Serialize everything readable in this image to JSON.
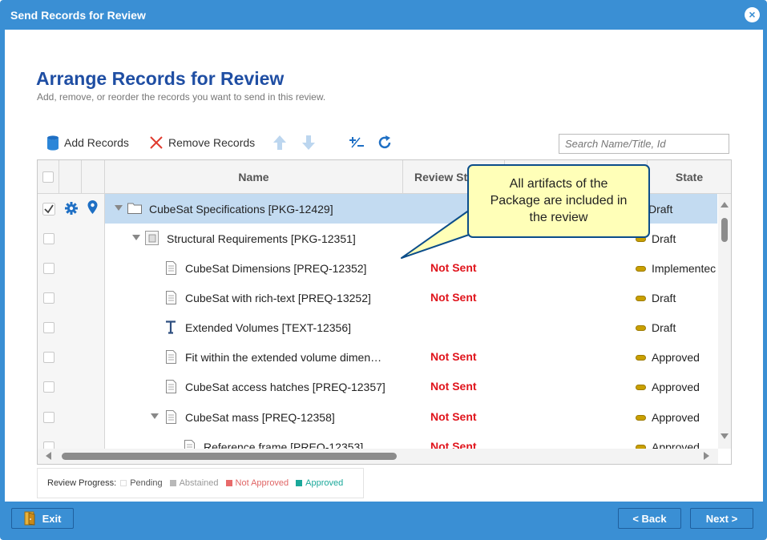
{
  "window": {
    "title": "Send Records for Review",
    "close_glyph": "×"
  },
  "header": {
    "title": "Arrange Records for Review",
    "subtitle": "Add, remove, or reorder the records you want to send in this review."
  },
  "toolbar": {
    "add_label": "Add Records",
    "remove_label": "Remove Records",
    "search_placeholder": "Search Name/Title, Id"
  },
  "grid": {
    "columns": {
      "name": "Name",
      "review_status": "Review St",
      "state": "State"
    },
    "rows": [
      {
        "name": "CubeSat Specifications [PKG-12429]",
        "status": "",
        "state": "Draft",
        "icon": "folder-icon",
        "depth": 0,
        "selected": true
      },
      {
        "name": "Structural Requirements [PKG-12351]",
        "status": "",
        "state": "Draft",
        "icon": "package-icon",
        "depth": 1,
        "selected": false
      },
      {
        "name": "CubeSat Dimensions [PREQ-12352]",
        "status": "Not Sent",
        "state": "Implementec",
        "icon": "document-icon",
        "depth": 2,
        "selected": false
      },
      {
        "name": "CubeSat with rich-text [PREQ-13252]",
        "status": "Not Sent",
        "state": "Draft",
        "icon": "document-icon",
        "depth": 2,
        "selected": false
      },
      {
        "name": "Extended Volumes [TEXT-12356]",
        "status": "",
        "state": "Draft",
        "icon": "text-icon",
        "depth": 2,
        "selected": false
      },
      {
        "name": "Fit within the extended volume dimen…",
        "status": "Not Sent",
        "state": "Approved",
        "icon": "document-icon",
        "depth": 2,
        "selected": false
      },
      {
        "name": "CubeSat access hatches [PREQ-12357]",
        "status": "Not Sent",
        "state": "Approved",
        "icon": "document-icon",
        "depth": 2,
        "selected": false
      },
      {
        "name": "CubeSat mass [PREQ-12358]",
        "status": "Not Sent",
        "state": "Approved",
        "icon": "document-icon",
        "depth": 2,
        "selected": false
      },
      {
        "name": "Reference frame [PREQ-12353]",
        "status": "Not Sent",
        "state": "Approved",
        "icon": "document-icon",
        "depth": 3,
        "selected": false
      }
    ]
  },
  "tooltip": {
    "line1": "All artifacts of the",
    "line2": "Package are included in",
    "line3": "the review"
  },
  "legend": {
    "label": "Review Progress:",
    "items": [
      {
        "label": "Pending",
        "color": "#ffffff",
        "text_color": "#555555"
      },
      {
        "label": "Abstained",
        "color": "#b8b8b8",
        "text_color": "#999999"
      },
      {
        "label": "Not Approved",
        "color": "#e86a6a",
        "text_color": "#e06666"
      },
      {
        "label": "Approved",
        "color": "#1aa89a",
        "text_color": "#1aa89a"
      }
    ]
  },
  "footer": {
    "exit_label": "Exit",
    "back_label": "< Back",
    "next_label": "Next >"
  },
  "colors": {
    "accent": "#3a8fd4",
    "heading": "#1f4ea3",
    "not_sent": "#e0141c",
    "selected_row": "#c3dbf1",
    "state_pill": "#c9a000"
  }
}
